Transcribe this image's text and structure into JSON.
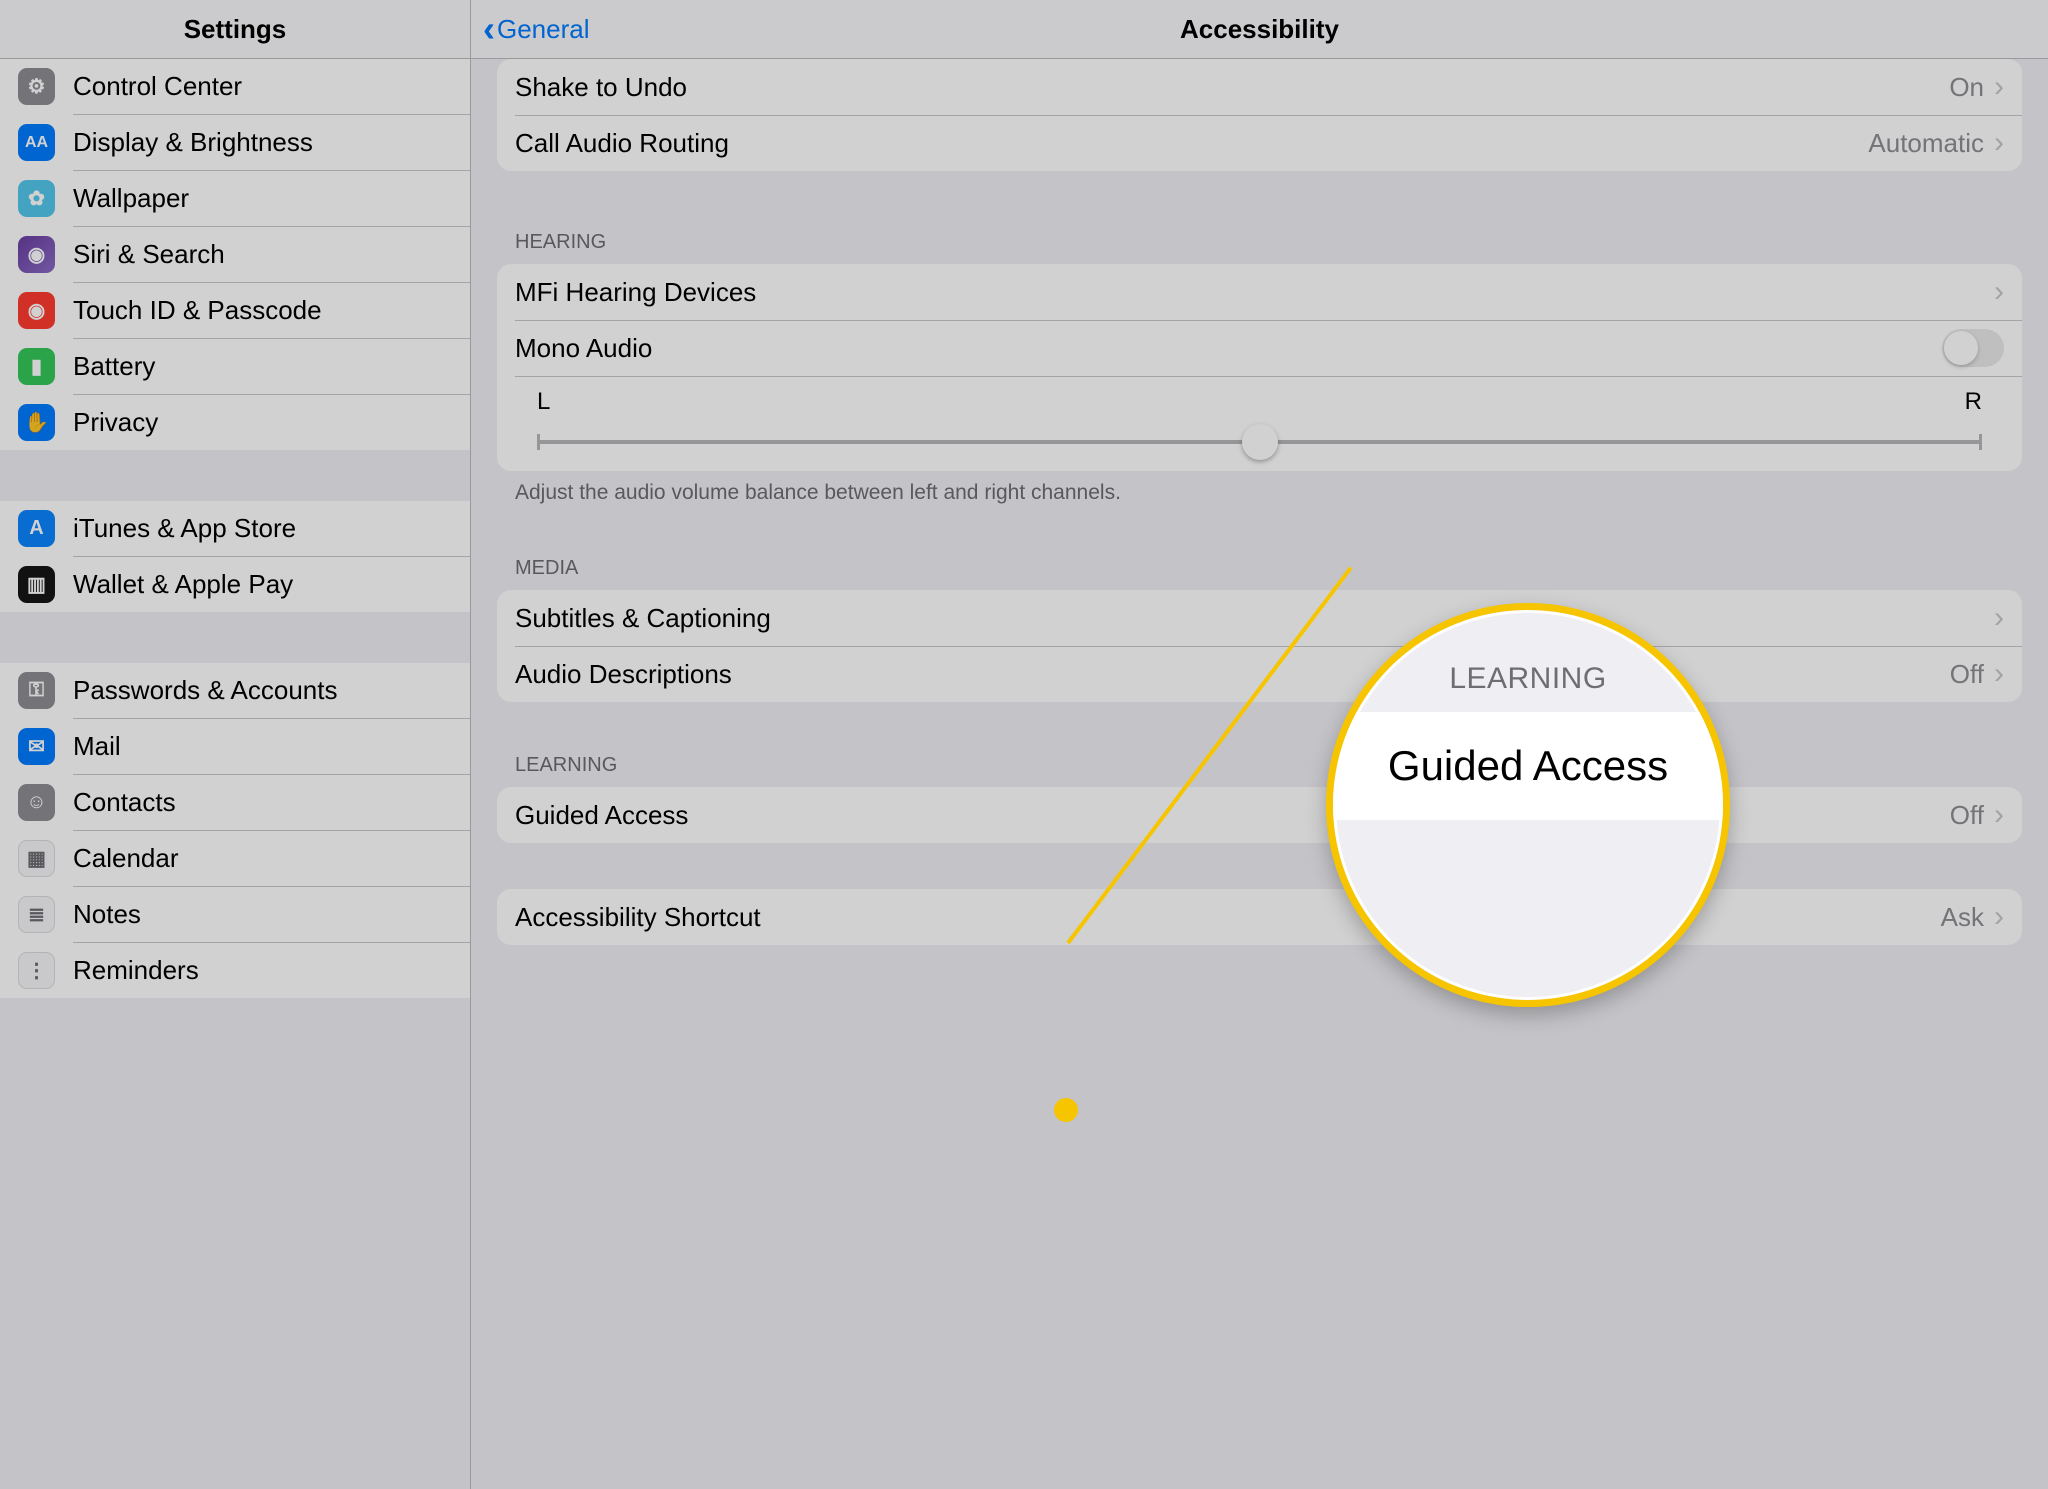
{
  "sidebar": {
    "title": "Settings",
    "groups": [
      {
        "items": [
          {
            "id": "control-center",
            "label": "Control Center",
            "icon": "switches-icon",
            "iconClass": "ic-gray"
          },
          {
            "id": "display-brightness",
            "label": "Display & Brightness",
            "icon": "aa-icon",
            "iconClass": "ic-blue"
          },
          {
            "id": "wallpaper",
            "label": "Wallpaper",
            "icon": "flower-icon",
            "iconClass": "ic-teal"
          },
          {
            "id": "siri-search",
            "label": "Siri & Search",
            "icon": "siri-icon",
            "iconClass": "ic-purple"
          },
          {
            "id": "touch-id",
            "label": "Touch ID & Passcode",
            "icon": "fingerprint-icon",
            "iconClass": "ic-red"
          },
          {
            "id": "battery",
            "label": "Battery",
            "icon": "battery-icon",
            "iconClass": "ic-green"
          },
          {
            "id": "privacy",
            "label": "Privacy",
            "icon": "hand-icon",
            "iconClass": "ic-blue"
          }
        ]
      },
      {
        "items": [
          {
            "id": "itunes-store",
            "label": "iTunes & App Store",
            "icon": "appstore-icon",
            "iconClass": "ic-navy"
          },
          {
            "id": "wallet-apple-pay",
            "label": "Wallet & Apple Pay",
            "icon": "wallet-icon",
            "iconClass": "ic-black"
          }
        ]
      },
      {
        "items": [
          {
            "id": "passwords-accounts",
            "label": "Passwords & Accounts",
            "icon": "key-icon",
            "iconClass": "ic-gray"
          },
          {
            "id": "mail",
            "label": "Mail",
            "icon": "mail-icon",
            "iconClass": "ic-blue"
          },
          {
            "id": "contacts",
            "label": "Contacts",
            "icon": "contacts-icon",
            "iconClass": "ic-gray"
          },
          {
            "id": "calendar",
            "label": "Calendar",
            "icon": "calendar-icon",
            "iconClass": "ic-white"
          },
          {
            "id": "notes",
            "label": "Notes",
            "icon": "notes-icon",
            "iconClass": "ic-white"
          },
          {
            "id": "reminders",
            "label": "Reminders",
            "icon": "reminders-icon",
            "iconClass": "ic-white"
          }
        ]
      }
    ]
  },
  "detail": {
    "back_label": "General",
    "title": "Accessibility",
    "sections": [
      {
        "items": [
          {
            "id": "shake-to-undo",
            "label": "Shake to Undo",
            "value": "On",
            "kind": "link"
          },
          {
            "id": "call-audio-routing",
            "label": "Call Audio Routing",
            "value": "Automatic",
            "kind": "link"
          }
        ]
      },
      {
        "header": "HEARING",
        "footer": "Adjust the audio volume balance between left and right channels.",
        "items": [
          {
            "id": "mfi-hearing",
            "label": "MFi Hearing Devices",
            "kind": "link"
          },
          {
            "id": "mono-audio",
            "label": "Mono Audio",
            "switch": false,
            "kind": "switch"
          },
          {
            "id": "balance",
            "kind": "balance",
            "left": "L",
            "right": "R"
          }
        ]
      },
      {
        "header": "MEDIA",
        "items": [
          {
            "id": "subtitles",
            "label": "Subtitles & Captioning",
            "kind": "link"
          },
          {
            "id": "audio-descriptions",
            "label": "Audio Descriptions",
            "value": "Off",
            "kind": "link"
          }
        ]
      },
      {
        "header": "LEARNING",
        "items": [
          {
            "id": "guided-access",
            "label": "Guided Access",
            "value": "Off",
            "kind": "link"
          }
        ]
      },
      {
        "items": [
          {
            "id": "accessibility-shortcut",
            "label": "Accessibility Shortcut",
            "value": "Ask",
            "kind": "link"
          }
        ]
      }
    ]
  },
  "callout": {
    "header": "LEARNING",
    "label": "Guided Access"
  },
  "section_top_margins": [
    0,
    60,
    52,
    52,
    46
  ]
}
